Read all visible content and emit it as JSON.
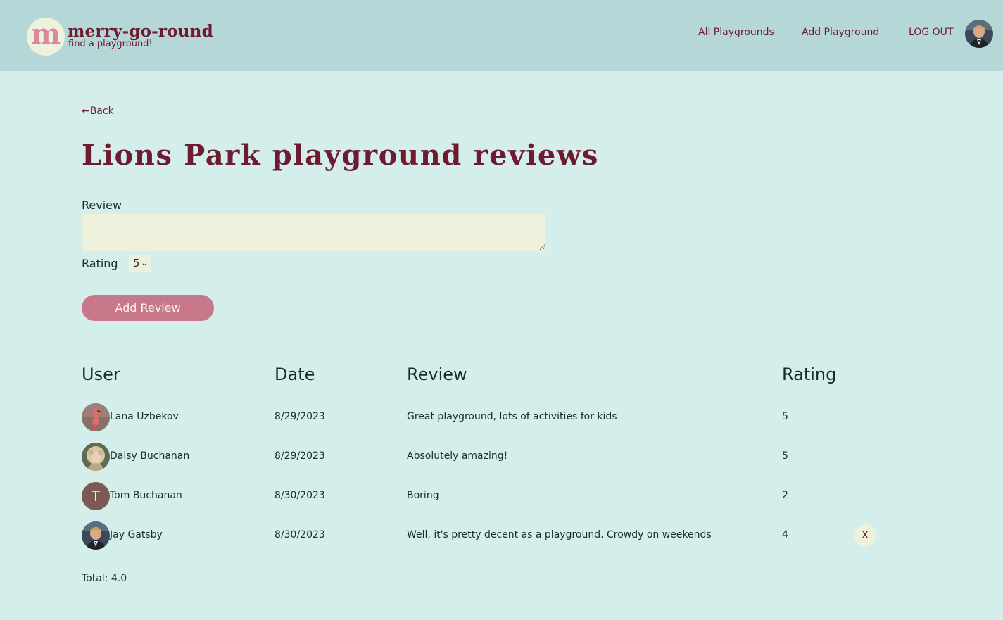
{
  "header": {
    "logo_letter": "m",
    "logo_title": "merry-go-round",
    "logo_tagline": "find a playground!",
    "nav": [
      {
        "label": "All Playgrounds"
      },
      {
        "label": "Add Playground"
      },
      {
        "label": "LOG OUT"
      }
    ]
  },
  "page": {
    "back_label": "←Back",
    "title": "Lions Park playground reviews"
  },
  "form": {
    "review_label": "Review",
    "review_value": "",
    "rating_label": "Rating",
    "rating_value": "5",
    "submit_label": "Add Review"
  },
  "table": {
    "columns": [
      "User",
      "Date",
      "Review",
      "Rating"
    ],
    "rows": [
      {
        "user": "Lana Uzbekov",
        "date": "8/29/2023",
        "review": "Great playground, lots of activities for kids",
        "rating": "5",
        "avatar": "flamingo-photo"
      },
      {
        "user": "Daisy Buchanan",
        "date": "8/29/2023",
        "review": "Absolutely amazing!",
        "rating": "5",
        "avatar": "portrait-photo"
      },
      {
        "user": "Tom Buchanan",
        "date": "8/30/2023",
        "review": "Boring",
        "rating": "2",
        "avatar": "letter",
        "avatar_letter": "T"
      },
      {
        "user": "Jay Gatsby",
        "date": "8/30/2023",
        "review": "Well, it's pretty decent as a playground. Crowdy on weekends",
        "rating": "4",
        "avatar": "portrait-photo",
        "delete_label": "X"
      }
    ],
    "total": "Total: 4.0"
  },
  "colors": {
    "brand": "#6e1a30",
    "accent_button": "#c9788c",
    "header_bg": "#b5d7d8",
    "page_bg": "#d4eeec",
    "input_bg": "#eef2dc"
  }
}
